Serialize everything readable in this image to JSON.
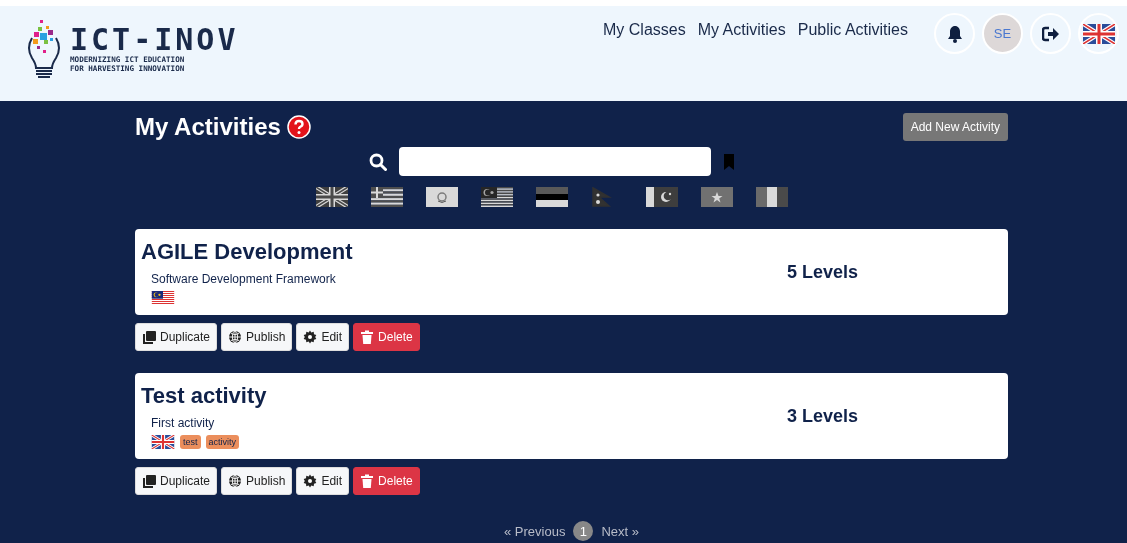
{
  "header": {
    "logo": {
      "title": "ICT-INOV",
      "subtitle_1": "MODERNIZING ICT EDUCATION",
      "subtitle_2": "FOR HARVESTING INNOVATION"
    },
    "nav": [
      "My Classes",
      "My Activities",
      "Public Activities"
    ],
    "avatar": "SE"
  },
  "page": {
    "title": "My Activities",
    "add_button": "Add New Activity",
    "language_filters": [
      {
        "kind": "uk",
        "selected": false
      },
      {
        "kind": "greece",
        "selected": false
      },
      {
        "kind": "cyprus",
        "selected": false
      },
      {
        "kind": "malaysia",
        "selected": false
      },
      {
        "kind": "estonia",
        "selected": false
      },
      {
        "kind": "nepal",
        "selected": false
      },
      {
        "kind": "pakistan",
        "selected": false
      },
      {
        "kind": "somalia",
        "selected": false
      },
      {
        "kind": "italy",
        "selected": false
      }
    ]
  },
  "activities": [
    {
      "title": "AGILE Development",
      "description": "Software Development Framework",
      "flag": {
        "kind": "malaysia"
      },
      "levels": "5 Levels",
      "actions": [
        "Duplicate",
        "Publish",
        "Edit",
        "Delete"
      ]
    },
    {
      "title": "Test activity",
      "description": "First activity",
      "flag": {
        "kind": "uk"
      },
      "tags": [
        "test",
        "activity"
      ],
      "levels": "3 Levels",
      "actions": [
        "Duplicate",
        "Publish",
        "Edit",
        "Delete"
      ]
    }
  ],
  "pagination": {
    "previous": "« Previous",
    "next": "Next »",
    "pages": [
      {
        "label": "1",
        "selected": true
      }
    ]
  }
}
